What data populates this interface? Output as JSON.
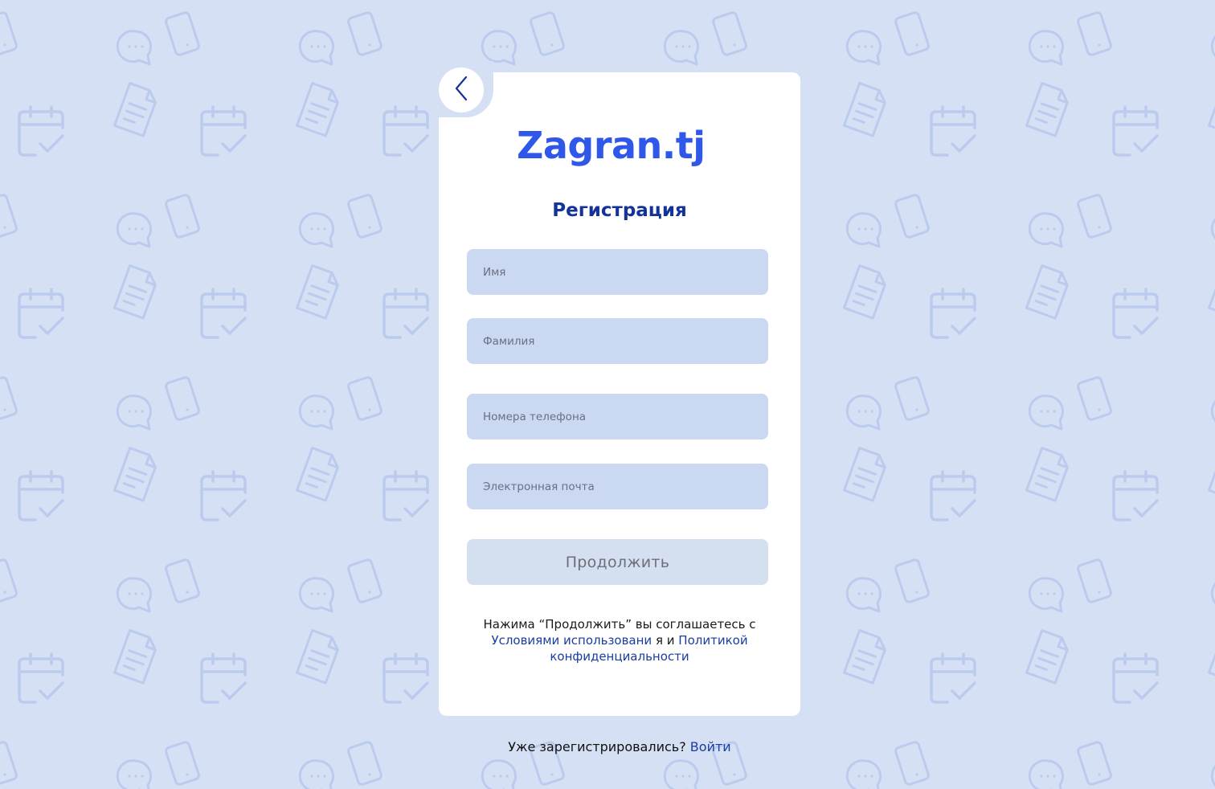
{
  "app": {
    "logo": "Zagran.tj"
  },
  "form": {
    "title": "Регистрация",
    "fields": [
      {
        "name": "first-name",
        "placeholder": "Имя",
        "value": ""
      },
      {
        "name": "last-name",
        "placeholder": "Фамилия",
        "value": ""
      },
      {
        "name": "phone",
        "placeholder": "Номера телефона",
        "value": ""
      },
      {
        "name": "email",
        "placeholder": "Электронная почта",
        "value": ""
      }
    ],
    "submit_label": "Продолжить",
    "terms": {
      "prefix": "Нажима “Продолжить” вы соглашаетесь с",
      "terms_link": "Условиями использовани",
      "middle": "я и",
      "privacy_link": "Политикой конфиденциальности"
    }
  },
  "footer": {
    "question": "Уже зарегистрировались?",
    "login_link": "Войти"
  },
  "icons": {
    "back": "chevron-left-icon",
    "pattern": [
      "chat-bubble-icon",
      "phone-icon",
      "document-icon",
      "calendar-check-icon"
    ]
  },
  "colors": {
    "background": "#d5e0f5",
    "pattern": "#bccbed",
    "brand": "#2f57ea",
    "heading": "#14339a",
    "field": "#cad8f2",
    "button": "#d4dfef",
    "link": "#1a3da0"
  }
}
